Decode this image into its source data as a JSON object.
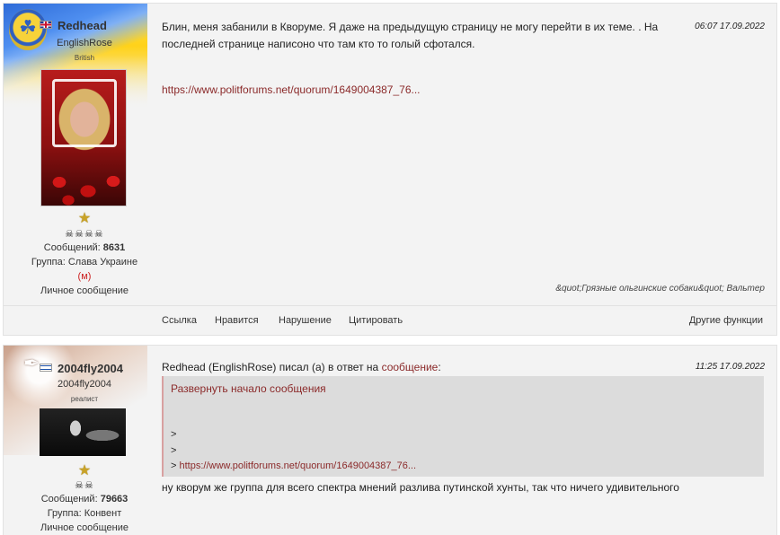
{
  "posts": [
    {
      "author": {
        "nick": "Redhead",
        "subnick": "EnglishRose",
        "rank": "British",
        "messages_label": "Сообщений:",
        "messages_count": "8631",
        "group_label": "Группа:",
        "group": "Слава Украине",
        "moder_mark": "(м)",
        "pm": "Личное сообщение",
        "flag": "uk-flag-icon",
        "emblem": "trident-icon",
        "star": "★",
        "skulls": "☠☠☠☠"
      },
      "time": "06:07 17.09.2022",
      "text": "Блин, меня забанили в Кворуме. Я даже на предыдущую страницу не могу перейти в их теме. . На последней странице написоно что там кто то голый сфотался.",
      "link": "https://www.politforums.net/quorum/1649004387_76...",
      "signature": "&quot;Грязные ольгинские собаки&quot; Вальтер",
      "actions": {
        "link": "Ссылка",
        "like": "Нравится",
        "violation": "Нарушение",
        "quote": "Цитировать",
        "other": "Другие функции"
      }
    },
    {
      "author": {
        "nick": "2004fly2004",
        "subnick": "2004fly2004",
        "rank": "реалист",
        "messages_label": "Сообщений:",
        "messages_count": "79663",
        "group_label": "Группа:",
        "group": "Конвент",
        "pm": "Личное сообщение",
        "flag": "israel-flag-icon",
        "emblem": "quill-icon",
        "star": "★",
        "skulls": "☠☠"
      },
      "time": "11:25 17.09.2022",
      "reply_prefix": "Redhead (EnglishRose) писал (а) в ответ на",
      "reply_link": "сообщение",
      "reply_colon": ":",
      "quote": {
        "expand": "Развернуть начало сообщения",
        "line1": ">",
        "line2": ">",
        "line3_prefix": ">",
        "line3_link": "https://www.politforums.net/quorum/1649004387_76..."
      },
      "text": "ну кворум же группа для всего спектра мнений разлива путинской хунты, так что ничего удивительного"
    }
  ]
}
